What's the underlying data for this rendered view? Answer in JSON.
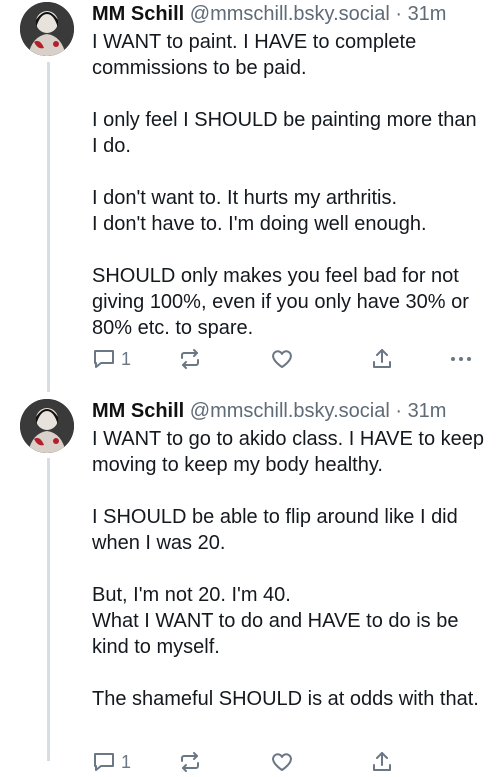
{
  "posts": [
    {
      "author": "MM Schill",
      "handle": "@mmschill.bsky.social",
      "separator": "·",
      "time": "31m",
      "paragraphs": [
        "I WANT to paint. I HAVE to complete commissions to be paid.",
        "I only feel I SHOULD be painting more than I do.",
        "I don't want to. It hurts my arthritis.\nI don't have to. I'm doing well enough.",
        "SHOULD only makes you feel bad for not giving 100%, even if you only have 30% or 80% etc. to spare."
      ],
      "reply_count": "1"
    },
    {
      "author": "MM Schill",
      "handle": "@mmschill.bsky.social",
      "separator": "·",
      "time": "31m",
      "paragraphs": [
        "I WANT to go to akido class. I HAVE to keep moving to keep my body healthy.",
        "I SHOULD be able to flip around like I did when I was 20.",
        "But, I'm not 20. I'm 40.\nWhat I WANT to do and HAVE to do is be kind to myself.",
        "The shameful SHOULD is at odds with that."
      ],
      "reply_count": "1"
    }
  ],
  "icons": {
    "reply": "speech-bubble-icon",
    "repost": "repost-arrows-icon",
    "like": "heart-icon",
    "share": "share-upload-icon",
    "more": "more-dots-icon"
  },
  "colors": {
    "action_gray": "#6b7785",
    "thread_line": "#d7dde3"
  }
}
